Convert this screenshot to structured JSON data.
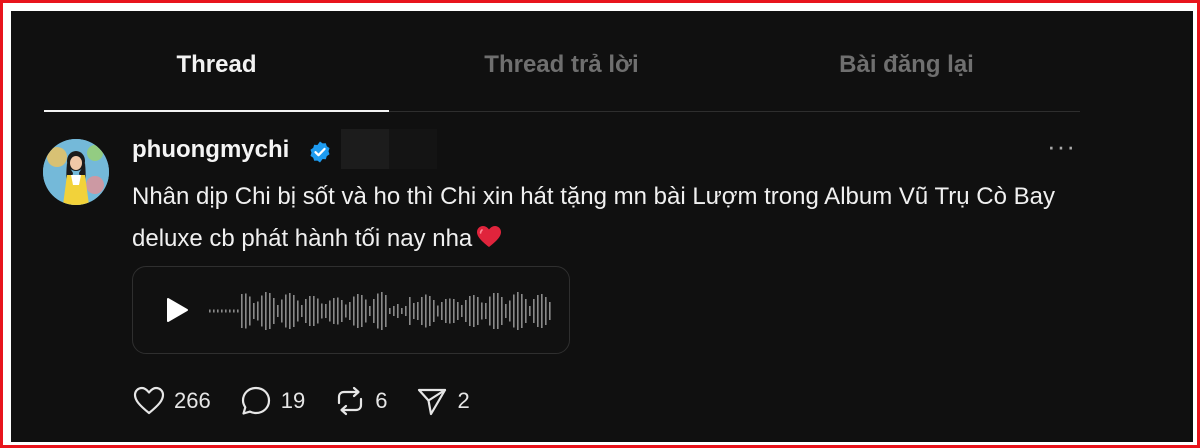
{
  "tabs": [
    {
      "label": "Thread",
      "active": true
    },
    {
      "label": "Thread trả lời",
      "active": false
    },
    {
      "label": "Bài đăng lại",
      "active": false
    }
  ],
  "post": {
    "username": "phuongmychi",
    "verified": true,
    "more_label": "···",
    "text": "Nhân dịp Chi bị sốt và ho thì Chi xin hát tặng mn bài Lượm trong Album Vũ Trụ Cò Bay deluxe cb phát hành tối nay nha",
    "emoji": "heart-emoji",
    "audio": {
      "play_icon": "play-icon",
      "waveform": "audio-waveform"
    },
    "actions": {
      "likes": "266",
      "comments": "19",
      "reposts": "6",
      "shares": "2"
    }
  },
  "colors": {
    "background": "#101010",
    "frame_border": "#e8141c",
    "text": "#f0f0f0",
    "inactive_tab": "#6f6f6f",
    "verified_blue": "#1d9bf0",
    "heart_red": "#e0243c"
  }
}
